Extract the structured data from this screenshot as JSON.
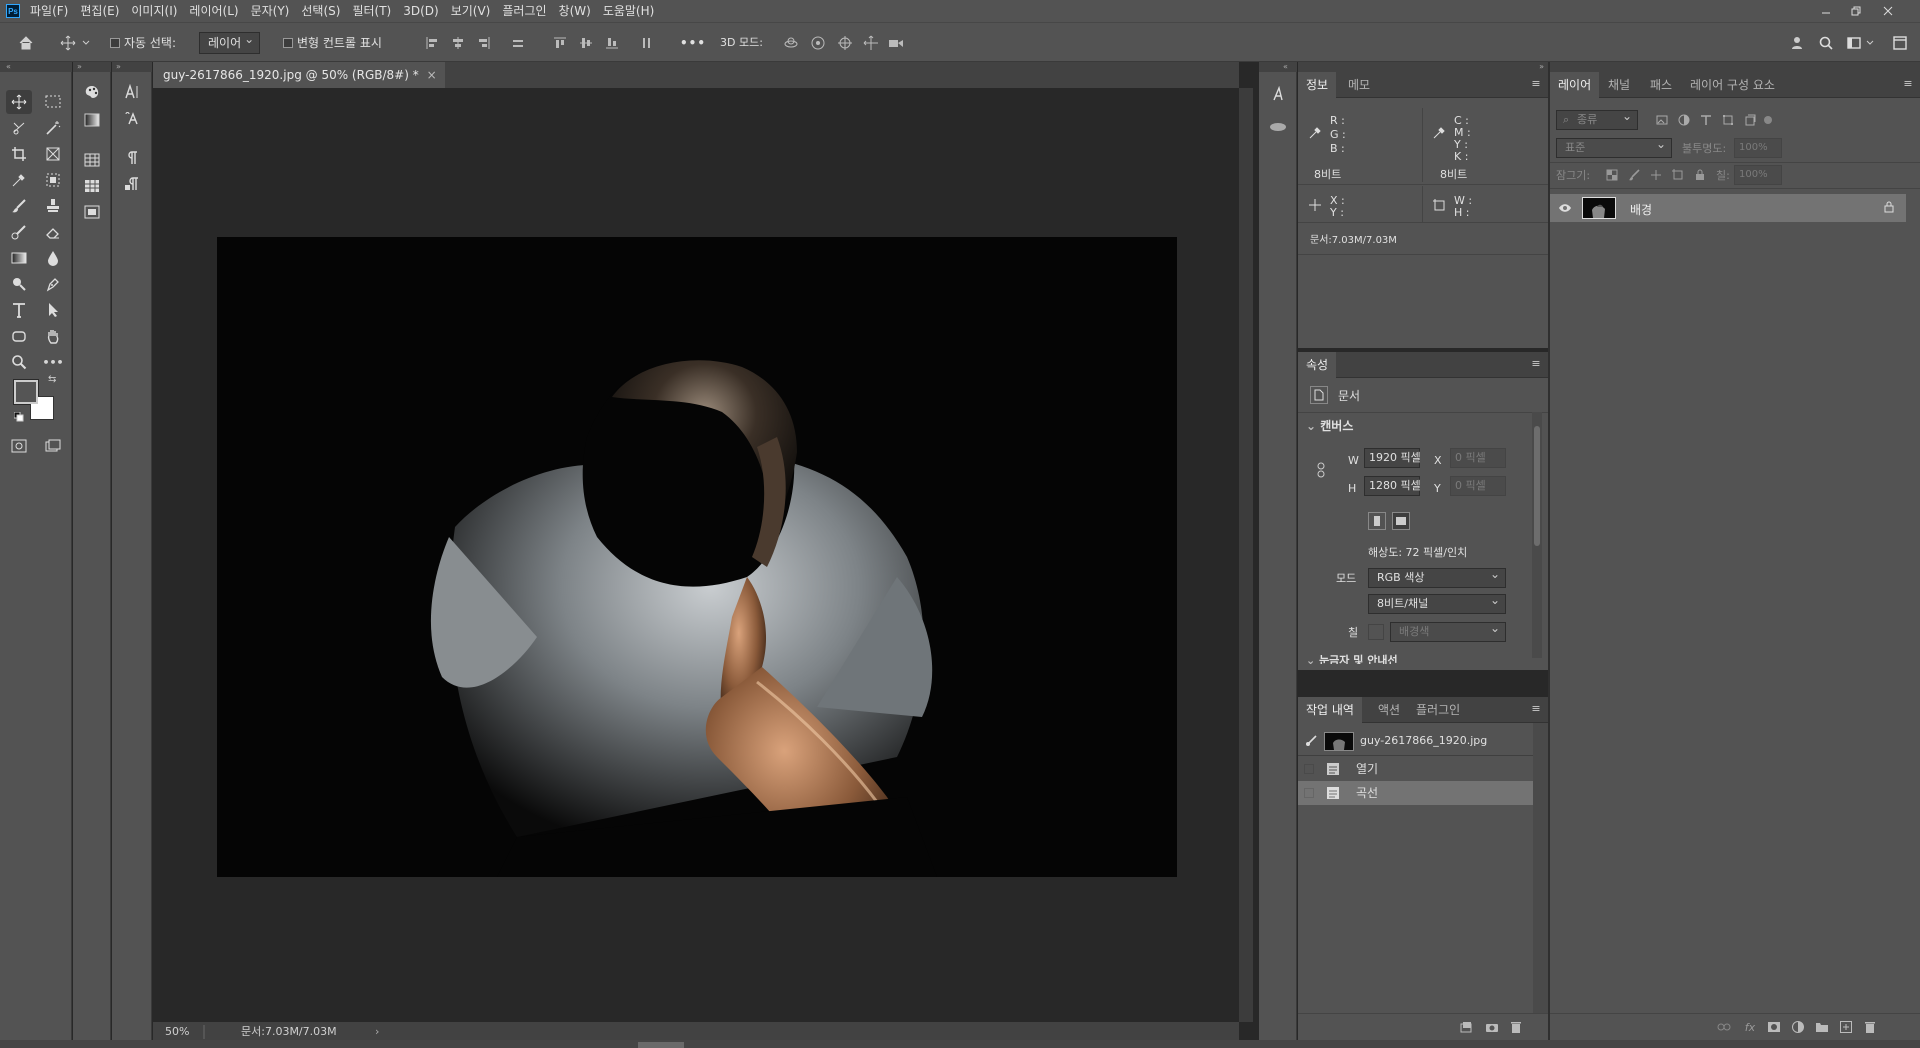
{
  "app": {
    "logo": "Ps"
  },
  "menu": [
    "파일(F)",
    "편집(E)",
    "이미지(I)",
    "레이어(L)",
    "문자(Y)",
    "선택(S)",
    "필터(T)",
    "3D(D)",
    "보기(V)",
    "플러그인",
    "창(W)",
    "도움말(H)"
  ],
  "options": {
    "auto_select_label": "자동 선택:",
    "auto_select_value": "레이어",
    "transform_label": "변형 컨트롤 표시",
    "more": "•••",
    "mode3d_label": "3D 모드:"
  },
  "document": {
    "tab_title": "guy-2617866_1920.jpg @ 50% (RGB/8#) *",
    "zoom": "50%",
    "doc_size": "문서:7.03M/7.03M"
  },
  "info_panel": {
    "tabs": [
      "정보",
      "메모"
    ],
    "rgb": [
      "R :",
      "G :",
      "B :"
    ],
    "cmyk": [
      "C :",
      "M :",
      "Y :",
      "K :"
    ],
    "bits_left": "8비트",
    "bits_right": "8비트",
    "xy": [
      "X :",
      "Y :"
    ],
    "wh": [
      "W :",
      "H :"
    ],
    "doc_size": "문서:7.03M/7.03M"
  },
  "properties_panel": {
    "tab": "속성",
    "kind": "문서",
    "section_canvas": "캔버스",
    "w_label": "W",
    "w_value": "1920 픽셀",
    "x_label": "X",
    "x_value": "0 픽셀",
    "h_label": "H",
    "h_value": "1280 픽셀",
    "y_label": "Y",
    "y_value": "0 픽셀",
    "resolution": "해상도: 72 픽셀/인치",
    "mode_label": "모드",
    "mode_value": "RGB 색상",
    "depth_value": "8비트/채널",
    "fill_label": "칠",
    "fill_value": "배경색",
    "next_section": "눈금자 및 안내선"
  },
  "history_panel": {
    "tabs": [
      "작업 내역",
      "액션",
      "플러그인"
    ],
    "snapshot": "guy-2617866_1920.jpg",
    "items": [
      "열기",
      "곡선"
    ]
  },
  "layers_panel": {
    "tabs": [
      "레이어",
      "채널",
      "패스",
      "레이어 구성 요소"
    ],
    "filter_value": "종류",
    "blend_value": "표준",
    "opacity_label": "불투명도:",
    "opacity_value": "100%",
    "lock_label": "잠그기:",
    "fill_label": "칠:",
    "fill_value": "100%",
    "layers": [
      {
        "name": "배경"
      }
    ]
  },
  "colors": {
    "panel": "#535353",
    "dark": "#282828",
    "selected_row": "#737373",
    "accent": "#31a8ff"
  }
}
